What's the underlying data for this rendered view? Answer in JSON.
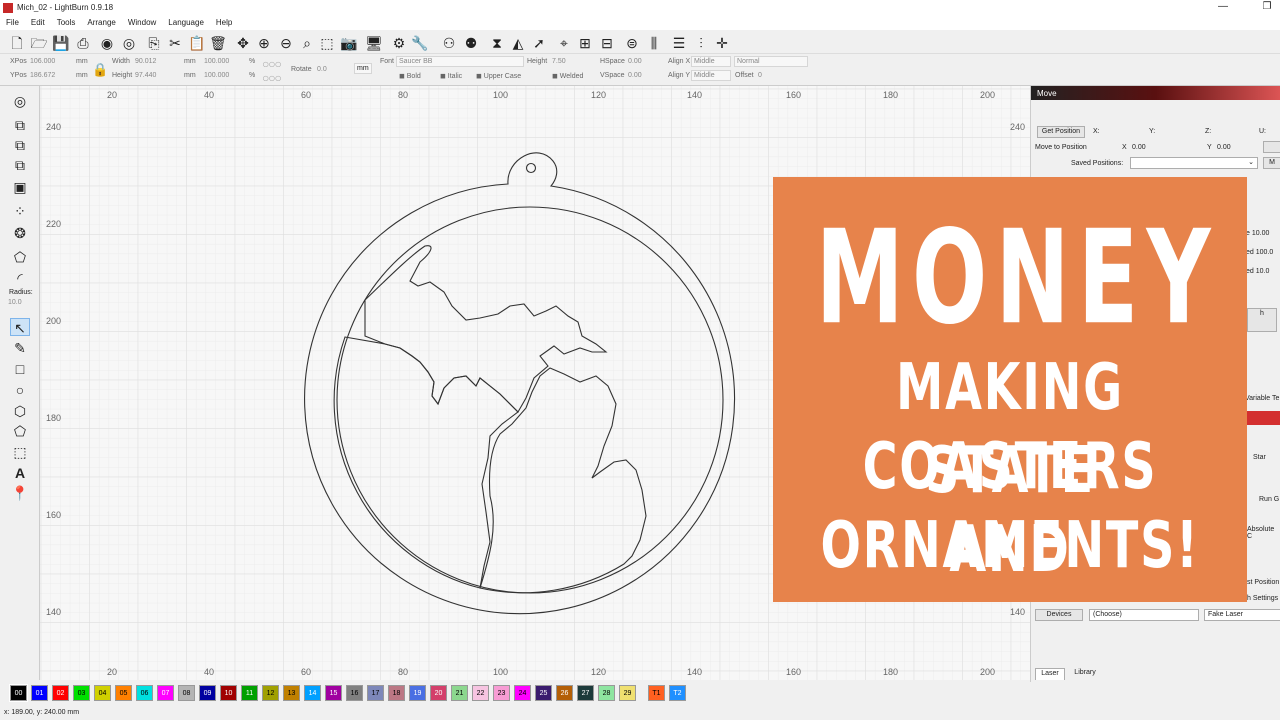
{
  "window": {
    "title": "Mich_02 - LightBurn 0.9.18",
    "minimize_glyph": "—",
    "restore_glyph": "❐"
  },
  "menu": [
    "File",
    "Edit",
    "Tools",
    "Arrange",
    "Window",
    "Language",
    "Help"
  ],
  "toolbar_icons": [
    "new-file-icon",
    "open-folder-icon",
    "save-icon",
    "export-icon",
    "import-icon",
    "settings-wheel-icon",
    "copy-icon",
    "cut-icon",
    "paste-icon",
    "delete-icon",
    "move-icon",
    "zoom-in-icon",
    "zoom-out-icon",
    "zoom-fit-icon",
    "select-rect-icon",
    "camera-icon",
    "monitor-icon",
    "machine-settings-icon",
    "tools-icon",
    "group-icon",
    "mirror-icon",
    "flip-icon",
    "send-icon",
    "target-icon",
    "align-icon",
    "distribute-icon",
    "align-h-icon",
    "align-v-icon",
    "spacing-icon",
    "center-icon"
  ],
  "props": {
    "xpos_label": "XPos",
    "xpos": "106.000",
    "ypos_label": "YPos",
    "ypos": "186.672",
    "unit": "mm",
    "width_label": "Width",
    "width": "90.012",
    "height_label": "Height",
    "height": "97.440",
    "scale_w": "100.000",
    "scale_h": "100.000",
    "percent": "%",
    "rotate_label": "Rotate",
    "rotate": "0.0",
    "mm_button": "mm",
    "font_label": "Font",
    "font": "Saucer BB",
    "text_height_label": "Height",
    "text_height": "7.50",
    "hspace_label": "HSpace",
    "hspace": "0.00",
    "vspace_label": "VSpace",
    "vspace": "0.00",
    "alignx_label": "Align X",
    "alignx": "Middle",
    "aligny_label": "Align Y",
    "aligny": "Middle",
    "style": "Normal",
    "offset_label": "Offset",
    "offset": "0",
    "bold": "Bold",
    "italic": "Italic",
    "upper_case": "Upper Case",
    "welded": "Welded"
  },
  "left_tools": {
    "radius_label": "Radius:",
    "radius_value": "10.0"
  },
  "ruler": {
    "top_ticks": [
      "20",
      "40",
      "60",
      "80",
      "100",
      "120",
      "140",
      "160",
      "180",
      "200"
    ],
    "left_ticks": [
      "240",
      "220",
      "200",
      "180",
      "160",
      "140"
    ],
    "right_ticks": [
      "240",
      "220",
      "200",
      "180",
      "160",
      "140"
    ]
  },
  "right_panel": {
    "move_title": "Move",
    "get_position": "Get Position",
    "x_label": "X:",
    "y_label": "Y:",
    "z_label": "Z:",
    "u_label": "U:",
    "move_to_position": "Move to Position",
    "move_x_label": "X",
    "move_x": "0.00",
    "move_y_label": "Y",
    "move_y": "0.00",
    "saved_positions": "Saved Positions:",
    "ma_button": "M",
    "peek_size": "e 10.00",
    "peek_speed1": "ed 100.0",
    "peek_speed2": "ed 10.0",
    "peek_h": "h",
    "peek_variable": "Variable Te",
    "peek_start": "Star",
    "peek_run": "Run G",
    "peek_absolute": "Absolute C",
    "peek_last_position": "st Position",
    "peek_settings": "h Settings",
    "devices": "Devices",
    "choose": "(Choose)",
    "fake_laser": "Fake Laser",
    "tab_laser": "Laser",
    "tab_library": "Library"
  },
  "promo": {
    "line1": "MONEY",
    "line2": "MAKING STATE",
    "line3": "COASTERS AND",
    "line4": "ORNAMENTS!",
    "background": "#e7834b"
  },
  "palette": [
    {
      "label": "00",
      "color": "#000000",
      "text": "#ffffff"
    },
    {
      "label": "01",
      "color": "#0000ff",
      "text": "#ffffff"
    },
    {
      "label": "02",
      "color": "#ff0000",
      "text": "#ffffff"
    },
    {
      "label": "03",
      "color": "#00e000",
      "text": "#000000"
    },
    {
      "label": "04",
      "color": "#d0d000",
      "text": "#000000"
    },
    {
      "label": "05",
      "color": "#ff8000",
      "text": "#000000"
    },
    {
      "label": "06",
      "color": "#00e0e0",
      "text": "#000000"
    },
    {
      "label": "07",
      "color": "#ff00ff",
      "text": "#ffffff"
    },
    {
      "label": "08",
      "color": "#b4b4b4",
      "text": "#000000"
    },
    {
      "label": "09",
      "color": "#0000a0",
      "text": "#ffffff"
    },
    {
      "label": "10",
      "color": "#a00000",
      "text": "#ffffff"
    },
    {
      "label": "11",
      "color": "#00a000",
      "text": "#ffffff"
    },
    {
      "label": "12",
      "color": "#a0a000",
      "text": "#000000"
    },
    {
      "label": "13",
      "color": "#c08000",
      "text": "#000000"
    },
    {
      "label": "14",
      "color": "#00a0ff",
      "text": "#ffffff"
    },
    {
      "label": "15",
      "color": "#a000a0",
      "text": "#ffffff"
    },
    {
      "label": "16",
      "color": "#808080",
      "text": "#000000"
    },
    {
      "label": "17",
      "color": "#7d87b9",
      "text": "#000000"
    },
    {
      "label": "18",
      "color": "#bb7784",
      "text": "#000000"
    },
    {
      "label": "19",
      "color": "#4a6fe3",
      "text": "#ffffff"
    },
    {
      "label": "20",
      "color": "#d33f6a",
      "text": "#ffffff"
    },
    {
      "label": "21",
      "color": "#8cd78e",
      "text": "#000000"
    },
    {
      "label": "22",
      "color": "#f6c4e1",
      "text": "#000000"
    },
    {
      "label": "23",
      "color": "#f79cd4",
      "text": "#000000"
    },
    {
      "label": "24",
      "color": "#ff00ff",
      "text": "#000000"
    },
    {
      "label": "25",
      "color": "#3a1b6e",
      "text": "#ffffff"
    },
    {
      "label": "26",
      "color": "#b45f06",
      "text": "#ffffff"
    },
    {
      "label": "27",
      "color": "#1c3a3a",
      "text": "#ffffff"
    },
    {
      "label": "28",
      "color": "#8ee5a0",
      "text": "#000000"
    },
    {
      "label": "29",
      "color": "#f0e070",
      "text": "#000000"
    },
    {
      "label": "T1",
      "color": "#ff6020",
      "text": "#000000"
    },
    {
      "label": "T2",
      "color": "#2090ff",
      "text": "#ffffff"
    }
  ],
  "status": "x: 189.00, y: 240.00 mm"
}
